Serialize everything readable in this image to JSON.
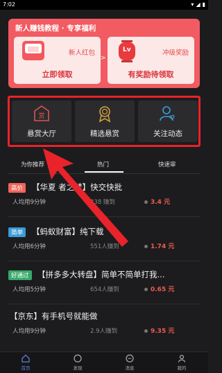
{
  "status_bar": {
    "time": "7:02"
  },
  "promo": {
    "title": "新人赚钱教程 · 专享福利",
    "left_card": {
      "label": "新人红包",
      "action": "立即领取"
    },
    "right_card": {
      "label": "冲级奖励",
      "action": "有奖励待领取",
      "lv_text": "Lv"
    },
    "arrow": ">"
  },
  "categories": [
    {
      "label": "悬赏大厅",
      "icon_char": "赏"
    },
    {
      "label": "精选悬赏"
    },
    {
      "label": "关注动态"
    }
  ],
  "tabs": [
    "为你推荐",
    "热门",
    "快速审"
  ],
  "tasks": [
    {
      "badge": "高价",
      "badge_color": "#f0655a",
      "title": "【华夏     者之梦】快交快批",
      "meta": "人均用9分钟",
      "earned": "338    赚到",
      "reward": "3.4 元"
    },
    {
      "badge": "简单",
      "badge_color": "#3b9bd6",
      "title": "【蚂蚁财富】纯下载",
      "meta": "人均用6分钟",
      "earned": "551人赚到",
      "reward": "1.74 元"
    },
    {
      "badge": "好通过",
      "badge_color": "#3aa86b",
      "title": "【拼多多大转盘】简单不简单打我...",
      "meta": "人均用5分钟",
      "earned": "654人赚到",
      "reward": "0.65 元"
    },
    {
      "badge": "",
      "badge_color": "",
      "title": "【京东】有手机号就能做",
      "meta": "人均用9分钟",
      "earned": "2.9人赚到",
      "reward": "9.35 元"
    }
  ],
  "bottom_nav": [
    "首页",
    "发现",
    "消息",
    "我的"
  ],
  "colors": {
    "accent": "#f15b61",
    "highlight": "#e8232b"
  }
}
